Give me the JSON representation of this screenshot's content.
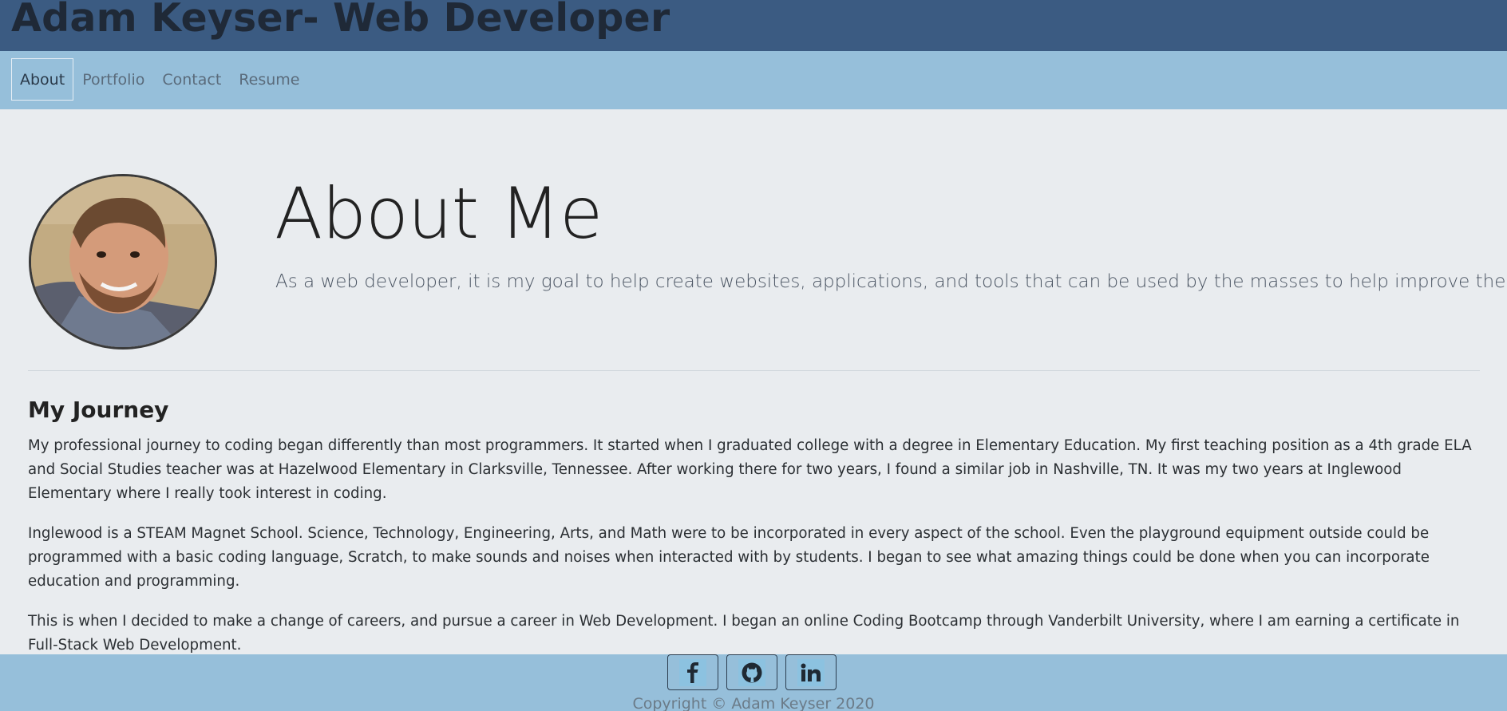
{
  "header": {
    "title": "Adam Keyser- Web Developer"
  },
  "nav": {
    "items": [
      {
        "label": "About",
        "active": true
      },
      {
        "label": "Portfolio",
        "active": false
      },
      {
        "label": "Contact",
        "active": false
      },
      {
        "label": "Resume",
        "active": false
      }
    ]
  },
  "hero": {
    "title": "About Me",
    "lead": "As a web developer, it is my goal to help create websites, applications, and tools that can be used by the masses to help improve their lives."
  },
  "journey": {
    "heading": "My Journey",
    "paragraphs": [
      "My professional journey to coding began differently than most programmers. It started when I graduated college with a degree in Elementary Education. My first teaching position as a 4th grade ELA and Social Studies teacher was at Hazelwood Elementary in Clarksville, Tennessee. After working there for two years, I found a similar job in Nashville, TN. It was my two years at Inglewood Elementary where I really took interest in coding.",
      "Inglewood is a STEAM Magnet School. Science, Technology, Engineering, Arts, and Math were to be incorporated in every aspect of the school. Even the playground equipment outside could be programmed with a basic coding language, Scratch, to make sounds and noises when interacted with by students. I began to see what amazing things could be done when you can incorporate education and programming.",
      "This is when I decided to make a change of careers, and pursue a career in Web Development. I began an online Coding Bootcamp through Vanderbilt University, where I am earning a certificate in Full-Stack Web Development."
    ]
  },
  "footer": {
    "social": [
      {
        "icon": "facebook-icon"
      },
      {
        "icon": "github-icon"
      },
      {
        "icon": "linkedin-icon"
      }
    ],
    "copyright": "Copyright © Adam Keyser 2020"
  },
  "colors": {
    "header_bg": "#3b5b82",
    "nav_bg": "#96bfda",
    "page_bg": "#e9ecef"
  }
}
